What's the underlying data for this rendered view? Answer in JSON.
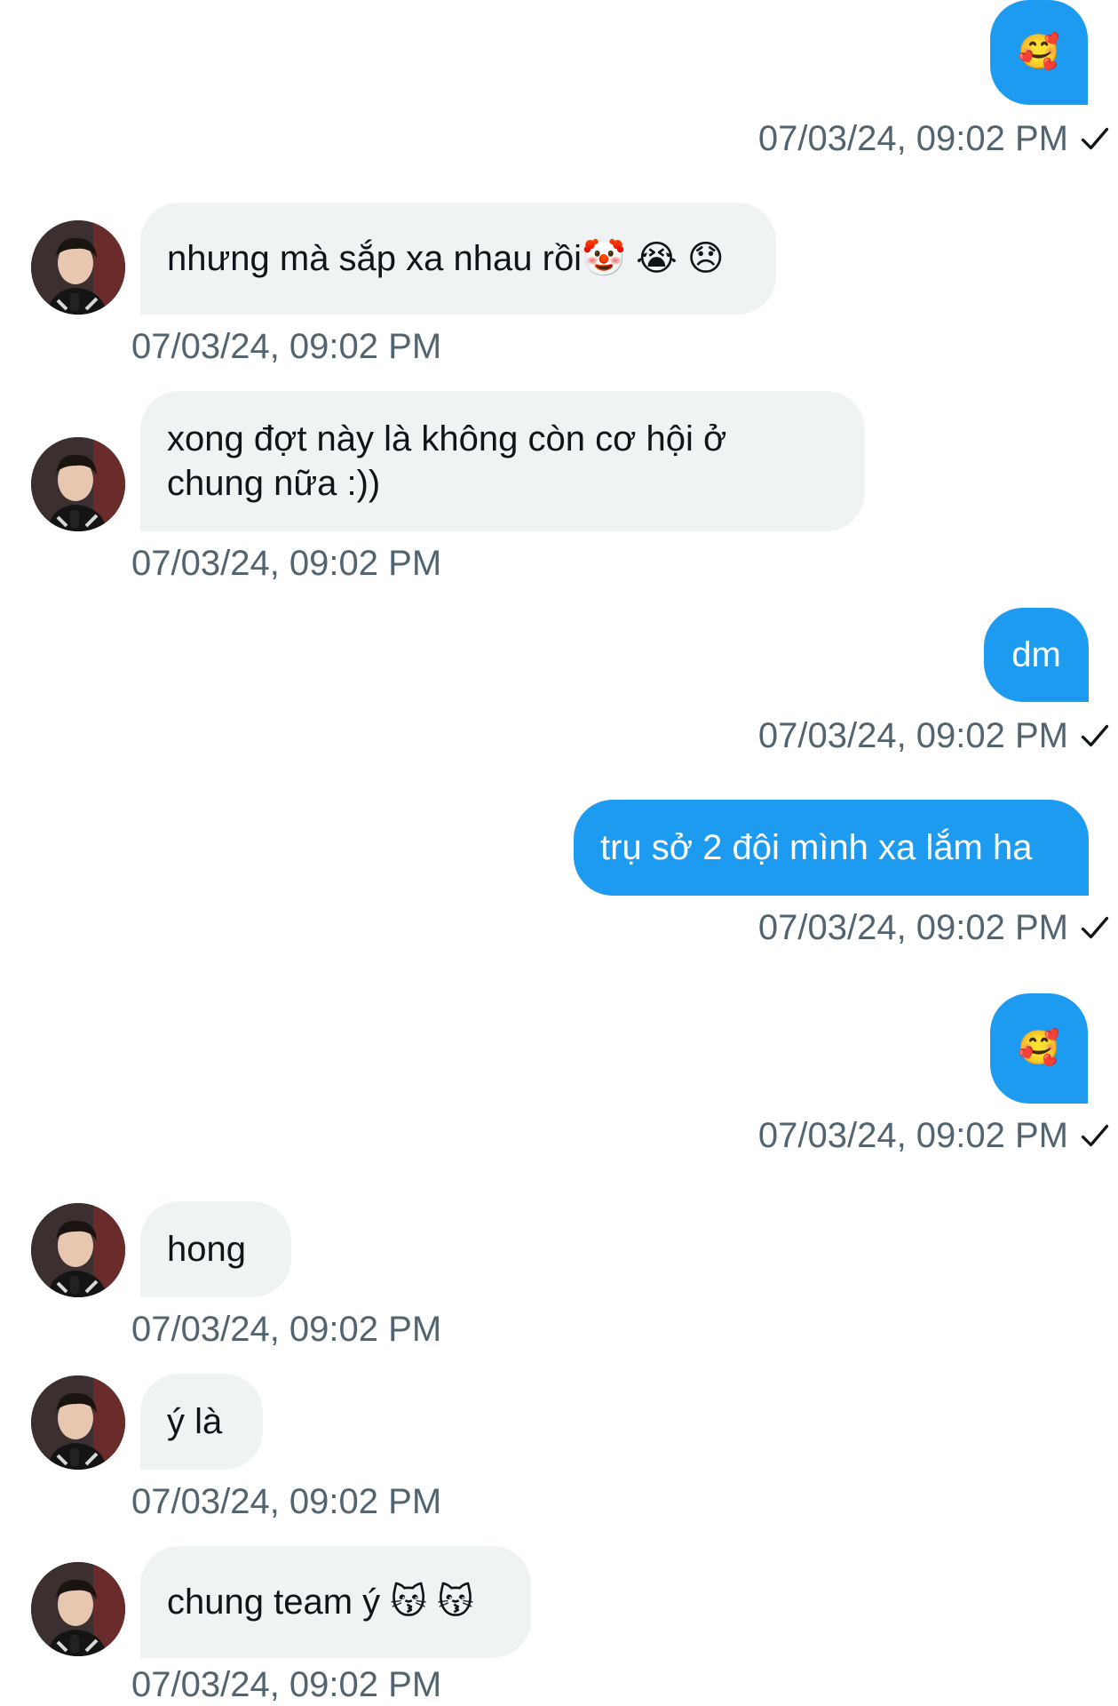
{
  "messages": [
    {
      "direction": "out",
      "text": "🥰",
      "timestamp": "07/03/24, 09:02 PM"
    },
    {
      "direction": "in",
      "text": "nhưng mà sắp xa nhau rồi🤡 😭 😞",
      "timestamp": "07/03/24, 09:02 PM"
    },
    {
      "direction": "in",
      "text": "xong đợt này là không còn cơ hội ở chung nữa :))",
      "timestamp": "07/03/24, 09:02 PM"
    },
    {
      "direction": "out",
      "text": "dm",
      "timestamp": "07/03/24, 09:02 PM"
    },
    {
      "direction": "out",
      "text": "trụ sở 2 đội mình xa lắm ha",
      "timestamp": "07/03/24, 09:02 PM"
    },
    {
      "direction": "out",
      "text": "🥰",
      "timestamp": "07/03/24, 09:02 PM"
    },
    {
      "direction": "in",
      "text": "hong",
      "timestamp": "07/03/24, 09:02 PM"
    },
    {
      "direction": "in",
      "text": "ý là",
      "timestamp": "07/03/24, 09:02 PM"
    },
    {
      "direction": "in",
      "text": "chung team ý 😽 😽",
      "timestamp": "07/03/24, 09:02 PM"
    }
  ],
  "icons": {
    "sent_status": "check-icon",
    "avatar": "contact-avatar"
  },
  "colors": {
    "outgoing_bubble": "#1d9bf0",
    "incoming_bubble": "#eff3f4",
    "timestamp_text": "#536471"
  }
}
